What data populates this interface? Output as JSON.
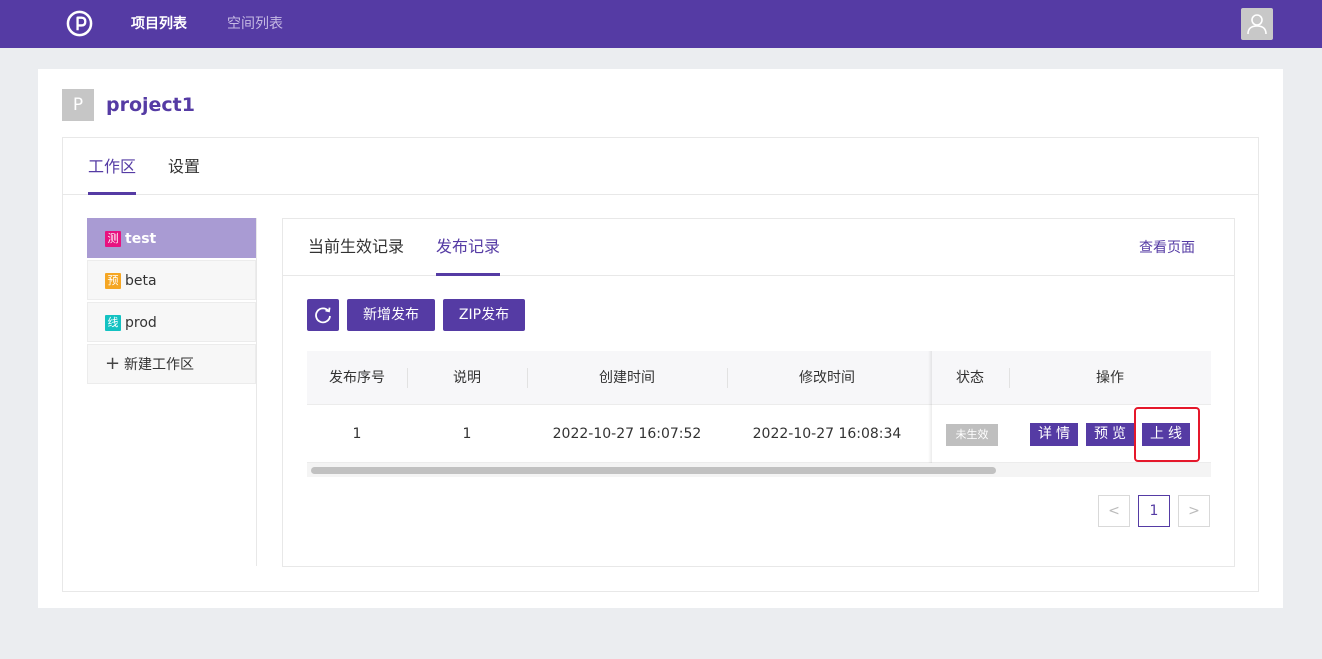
{
  "topbar": {
    "nav": [
      {
        "label": "项目列表",
        "active": true
      },
      {
        "label": "空间列表",
        "active": false
      }
    ],
    "logo_icon": "p-logo-icon",
    "avatar_icon": "user-icon"
  },
  "project": {
    "badge": "P",
    "name": "project1"
  },
  "tabs": [
    {
      "label": "工作区",
      "active": true
    },
    {
      "label": "设置",
      "active": false
    }
  ],
  "sidebar": {
    "items": [
      {
        "tag": "测",
        "tag_color": "#e8117f",
        "label": "test",
        "active": true
      },
      {
        "tag": "预",
        "tag_color": "#f5a623",
        "label": "beta",
        "active": false
      },
      {
        "tag": "线",
        "tag_color": "#13c2c2",
        "label": "prod",
        "active": false
      }
    ],
    "add_label": "新建工作区"
  },
  "panel": {
    "tabs": [
      {
        "label": "当前生效记录",
        "active": false
      },
      {
        "label": "发布记录",
        "active": true
      }
    ],
    "view_page_label": "查看页面",
    "buttons": {
      "refresh_icon": "refresh-icon",
      "new_release": "新增发布",
      "zip_release": "ZIP发布"
    }
  },
  "table": {
    "columns": [
      "发布序号",
      "说明",
      "创建时间",
      "修改时间",
      "状态",
      "操作"
    ],
    "rows": [
      {
        "seq": "1",
        "desc": "1",
        "created": "2022-10-27 16:07:52",
        "modified": "2022-10-27 16:08:34",
        "status": "未生效",
        "actions": [
          "详情",
          "预览",
          "上线"
        ]
      }
    ]
  },
  "pagination": {
    "prev": "<",
    "current": "1",
    "next": ">"
  },
  "colors": {
    "brand": "#553ba4",
    "sidebar_active": "#a99bd3",
    "status_inactive": "#bfbfbf",
    "highlight": "#e5182b"
  }
}
